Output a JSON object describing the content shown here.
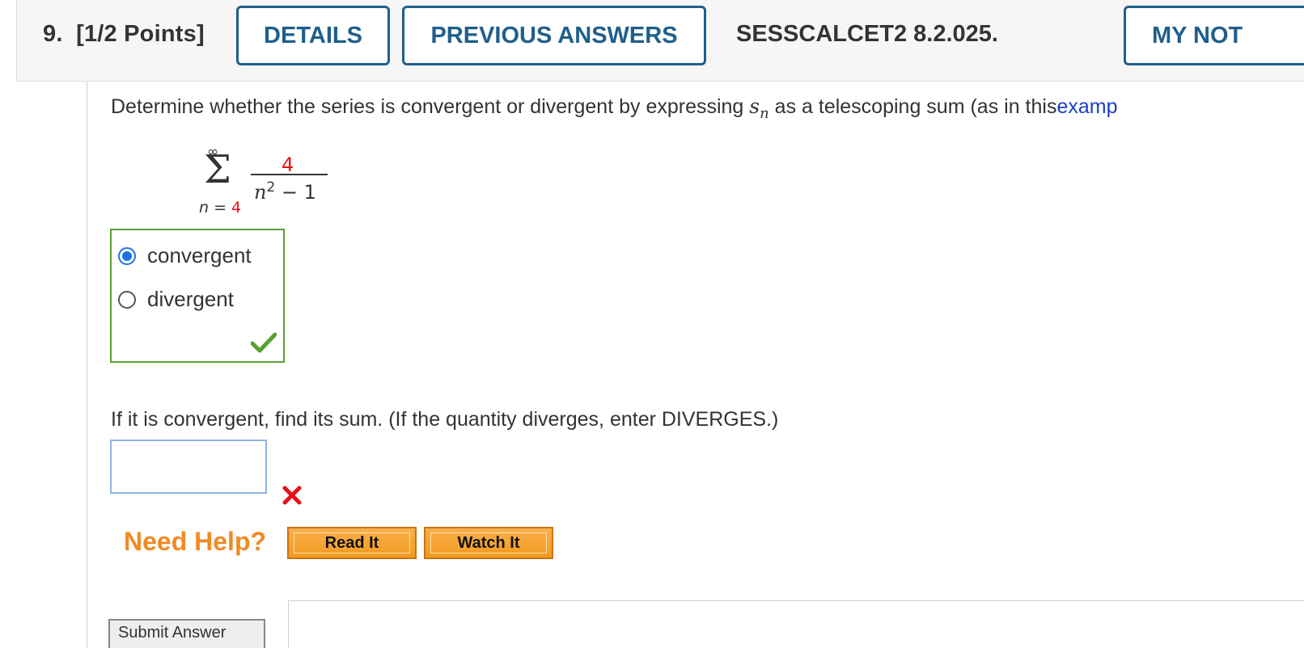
{
  "header": {
    "question_number": "9.",
    "points": "[1/2 Points]",
    "details_label": "DETAILS",
    "previous_answers_label": "PREVIOUS ANSWERS",
    "question_id": "SESSCALCET2 8.2.025.",
    "my_notes_label": "MY NOT"
  },
  "prompt": {
    "text_before": "Determine whether the series is convergent or divergent by expressing ",
    "s": "s",
    "sub": "n",
    "text_after": " as a telescoping sum (as in this",
    "link": "examp"
  },
  "series": {
    "upper": "∞",
    "sigma": "Σ",
    "index": "n",
    "lower_eq": " = ",
    "lower_value": "4",
    "numerator": "4",
    "den_var": "n",
    "den_exp": "2",
    "den_rest": " − 1"
  },
  "choices": {
    "options": [
      "convergent",
      "divergent"
    ],
    "selected": "convergent"
  },
  "question2": {
    "text": "If it is convergent, find its sum. (If the quantity diverges, enter DIVERGES.)",
    "answer_value": ""
  },
  "help": {
    "label": "Need Help?",
    "read_it": "Read It",
    "watch_it": "Watch It"
  },
  "submit": {
    "label": "Submit Answer"
  },
  "colors": {
    "accent": "#1f5f8b",
    "correct": "#5aa032",
    "incorrect": "#e8121b",
    "help": "#f08a24"
  }
}
